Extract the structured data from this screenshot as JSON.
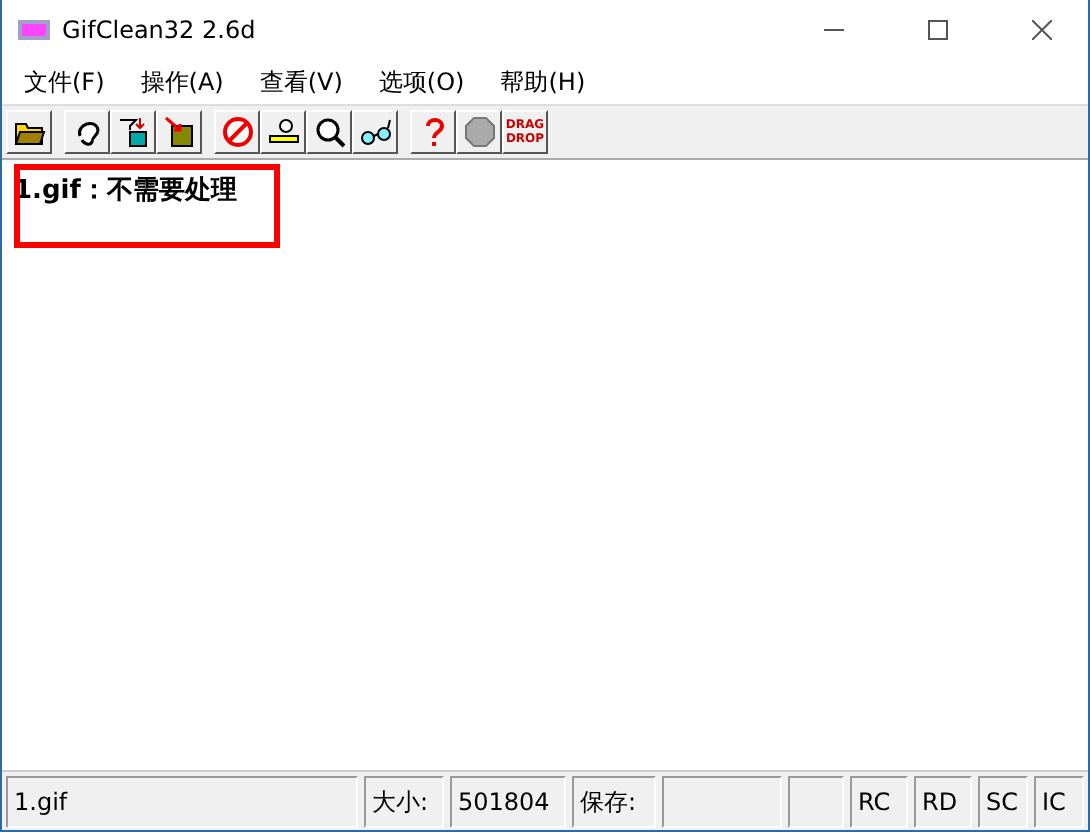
{
  "window": {
    "title": "GifClean32 2.6d"
  },
  "menu": [
    {
      "label": "文件(F)"
    },
    {
      "label": "操作(A)"
    },
    {
      "label": "查看(V)"
    },
    {
      "label": "选项(O)"
    },
    {
      "label": "帮助(H)"
    }
  ],
  "toolbar": [
    [
      {
        "kind": "open"
      }
    ],
    [
      {
        "kind": "ear"
      },
      {
        "kind": "filter"
      },
      {
        "kind": "import"
      }
    ],
    [
      {
        "kind": "forbid"
      },
      {
        "kind": "measure"
      },
      {
        "kind": "zoom"
      },
      {
        "kind": "glasses"
      }
    ],
    [
      {
        "kind": "help"
      },
      {
        "kind": "stop"
      },
      {
        "kind": "text",
        "lines": [
          "DRAG",
          "DROP"
        ]
      }
    ]
  ],
  "log": {
    "highlighted": true,
    "lines": [
      "1.gif：不需要处理"
    ]
  },
  "status_bar": [
    {
      "kind": "text",
      "text": "1.gif"
    },
    {
      "kind": "text",
      "text": "大小:"
    },
    {
      "kind": "text",
      "text": "501804"
    },
    {
      "kind": "text",
      "text": "保存:"
    },
    {
      "kind": "blank"
    },
    {
      "kind": "blank"
    },
    {
      "kind": "text",
      "text": "RC"
    },
    {
      "kind": "text",
      "text": "RD"
    },
    {
      "kind": "text",
      "text": "SC"
    },
    {
      "kind": "text",
      "text": "IC"
    }
  ]
}
